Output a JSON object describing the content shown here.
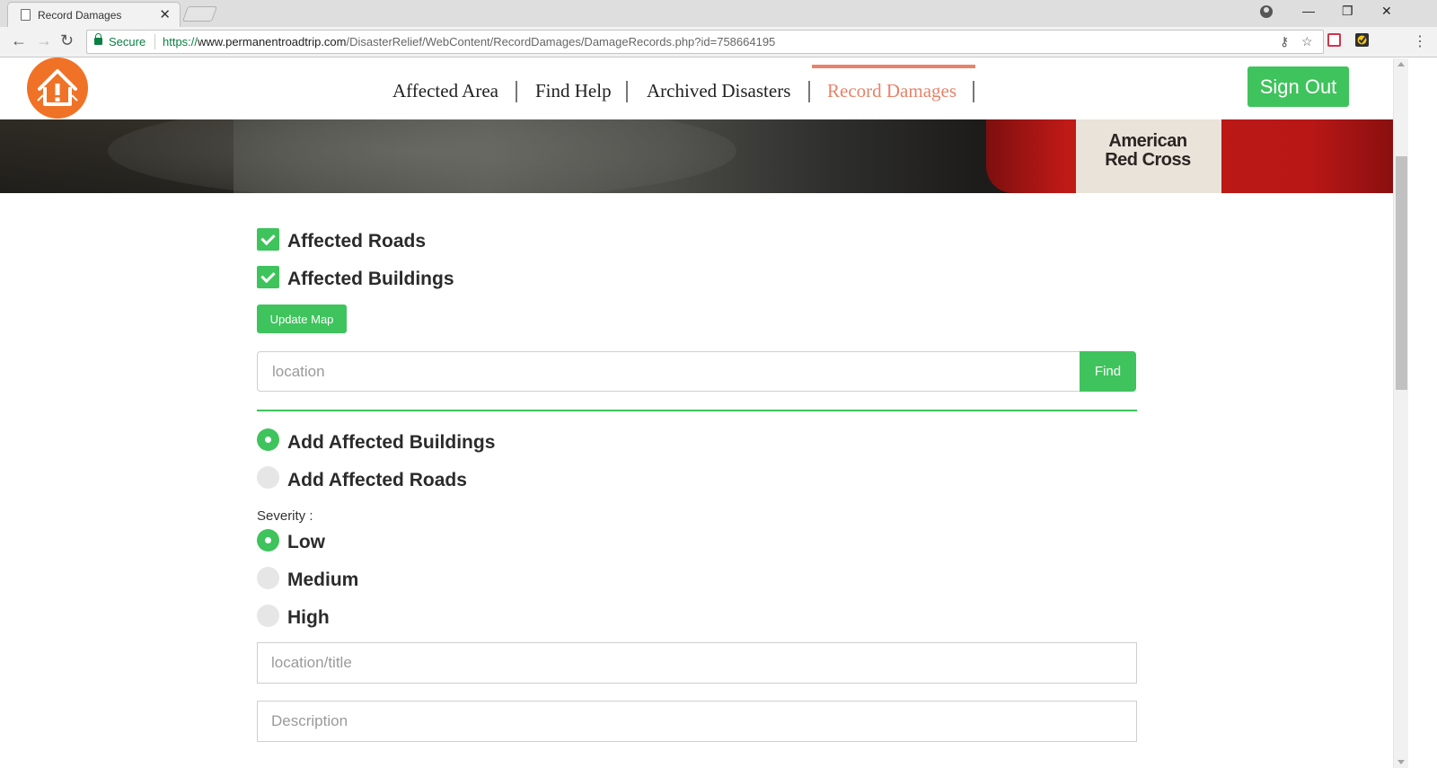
{
  "browser": {
    "tab_title": "Record Damages",
    "tab_close": "✕",
    "window_controls": {
      "minimize": "—",
      "maximize": "❐",
      "close": "✕"
    },
    "nav": {
      "back": "←",
      "forward": "→",
      "reload": "↻"
    },
    "secure_label": "Secure",
    "url_scheme": "https://",
    "url_host": "www.permanentroadtrip.com",
    "url_path": "/DisasterRelief/WebContent/RecordDamages/DamageRecords.php?id=758664195",
    "icons": [
      "page-icon",
      "lock-icon",
      "key-icon",
      "star-icon",
      "pocket-extension-icon",
      "checkmark-extension-icon",
      "menu-icon"
    ],
    "key_glyph": "⚷",
    "star_glyph": "☆",
    "menu_glyph": "⋮"
  },
  "header": {
    "logo_icon": "house-alert-icon",
    "nav_items": [
      {
        "label": "Affected Area",
        "active": false
      },
      {
        "label": "Find Help",
        "active": false
      },
      {
        "label": "Archived Disasters",
        "active": false
      },
      {
        "label": "Record Damages",
        "active": true
      }
    ],
    "sign_out_label": "Sign Out"
  },
  "hero": {
    "vest_text_line1": "American",
    "vest_text_line2": "Red Cross"
  },
  "filters": {
    "affected_roads": {
      "label": "Affected Roads",
      "checked": true
    },
    "affected_buildings": {
      "label": "Affected Buildings",
      "checked": true
    },
    "update_button_label": "Update Map"
  },
  "search": {
    "placeholder": "location",
    "value": "",
    "button_label": "Find"
  },
  "add_mode": {
    "options": [
      {
        "label": "Add Affected Buildings",
        "selected": true
      },
      {
        "label": "Add Affected Roads",
        "selected": false
      }
    ]
  },
  "severity": {
    "label": "Severity :",
    "options": [
      {
        "label": "Low",
        "selected": true
      },
      {
        "label": "Medium",
        "selected": false
      },
      {
        "label": "High",
        "selected": false
      }
    ]
  },
  "form": {
    "title_placeholder": "location/title",
    "description_placeholder": "Description"
  },
  "colors": {
    "accent_green": "#3fc35c",
    "brand_orange": "#f07226",
    "active_nav": "#e8826a"
  }
}
